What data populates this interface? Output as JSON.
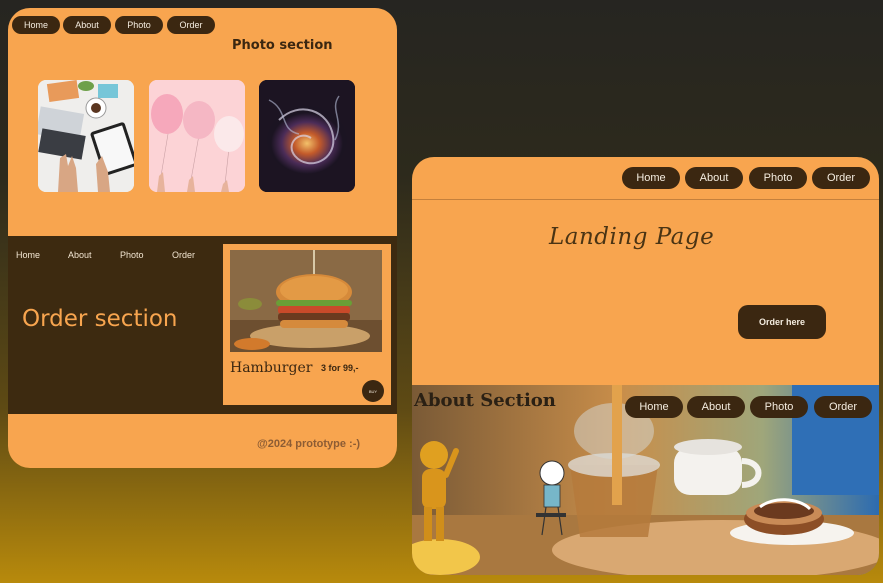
{
  "left_card": {
    "nav": [
      "Home",
      "About",
      "Photo",
      "Order"
    ],
    "photo_title": "Photo section",
    "photos": [
      "workspace-photo",
      "balloons-photo",
      "swirl-photo"
    ],
    "order_nav": [
      "Home",
      "About",
      "Photo",
      "Order"
    ],
    "order_title": "Order section",
    "product": {
      "name": "Hamburger",
      "price": "3 for 99,-",
      "buy_label": "BUY"
    },
    "footer": "@2024 prototype :-)"
  },
  "right_card": {
    "nav": [
      "Home",
      "About",
      "Photo",
      "Order"
    ],
    "landing_title": "Landing Page",
    "order_button": "Order here",
    "about_title": "About Section",
    "about_nav": [
      "Home",
      "About",
      "Photo",
      "Order"
    ]
  },
  "colors": {
    "accent": "#f8a54f",
    "dark": "#3b2711",
    "band": "#3d2a10"
  }
}
